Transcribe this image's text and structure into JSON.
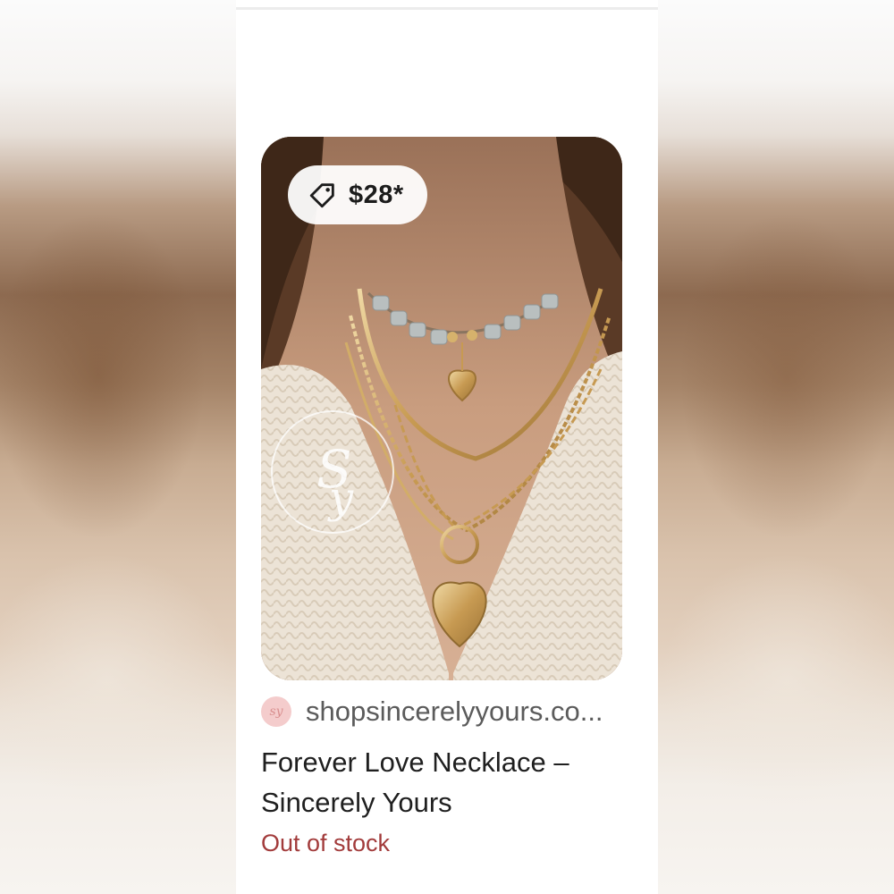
{
  "product": {
    "price": "$28*",
    "price_icon": "tag-icon",
    "image_alt": "Layered gold necklaces worn with a cream knit cardigan",
    "watermark_text": "SY",
    "source": "shopsincerelyyours.co...",
    "source_avatar_text": "sy",
    "title_line1": "Forever Love Necklace –",
    "title_line2": "Sincerely Yours",
    "stock_status": "Out of stock"
  },
  "colors": {
    "stock_status": "#a23b3b",
    "source_avatar_bg": "#f4cccc",
    "card_bg": "#ffffff"
  }
}
